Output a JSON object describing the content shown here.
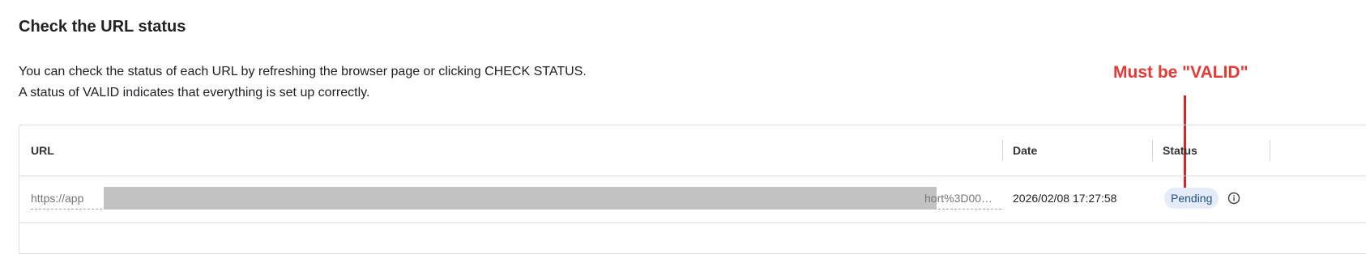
{
  "section": {
    "title": "Check the URL status",
    "description_line1": "You can check the status of each URL by refreshing the browser page or clicking CHECK STATUS.",
    "description_line2": "A status of VALID indicates that everything is set up correctly."
  },
  "table": {
    "headers": {
      "url": "URL",
      "date": "Date",
      "status": "Status"
    },
    "rows": [
      {
        "url_start": "https://app",
        "url_end": "hort%3D00…",
        "date": "2026/02/08 17:27:58",
        "status": "Pending",
        "status_icon": "info-icon"
      }
    ]
  },
  "annotation": {
    "text": "Must be \"VALID\"",
    "color": "#e53935"
  },
  "colors": {
    "badge_bg": "#e3ecf7",
    "badge_text": "#1f4e8c",
    "annotation": "#e53935"
  }
}
